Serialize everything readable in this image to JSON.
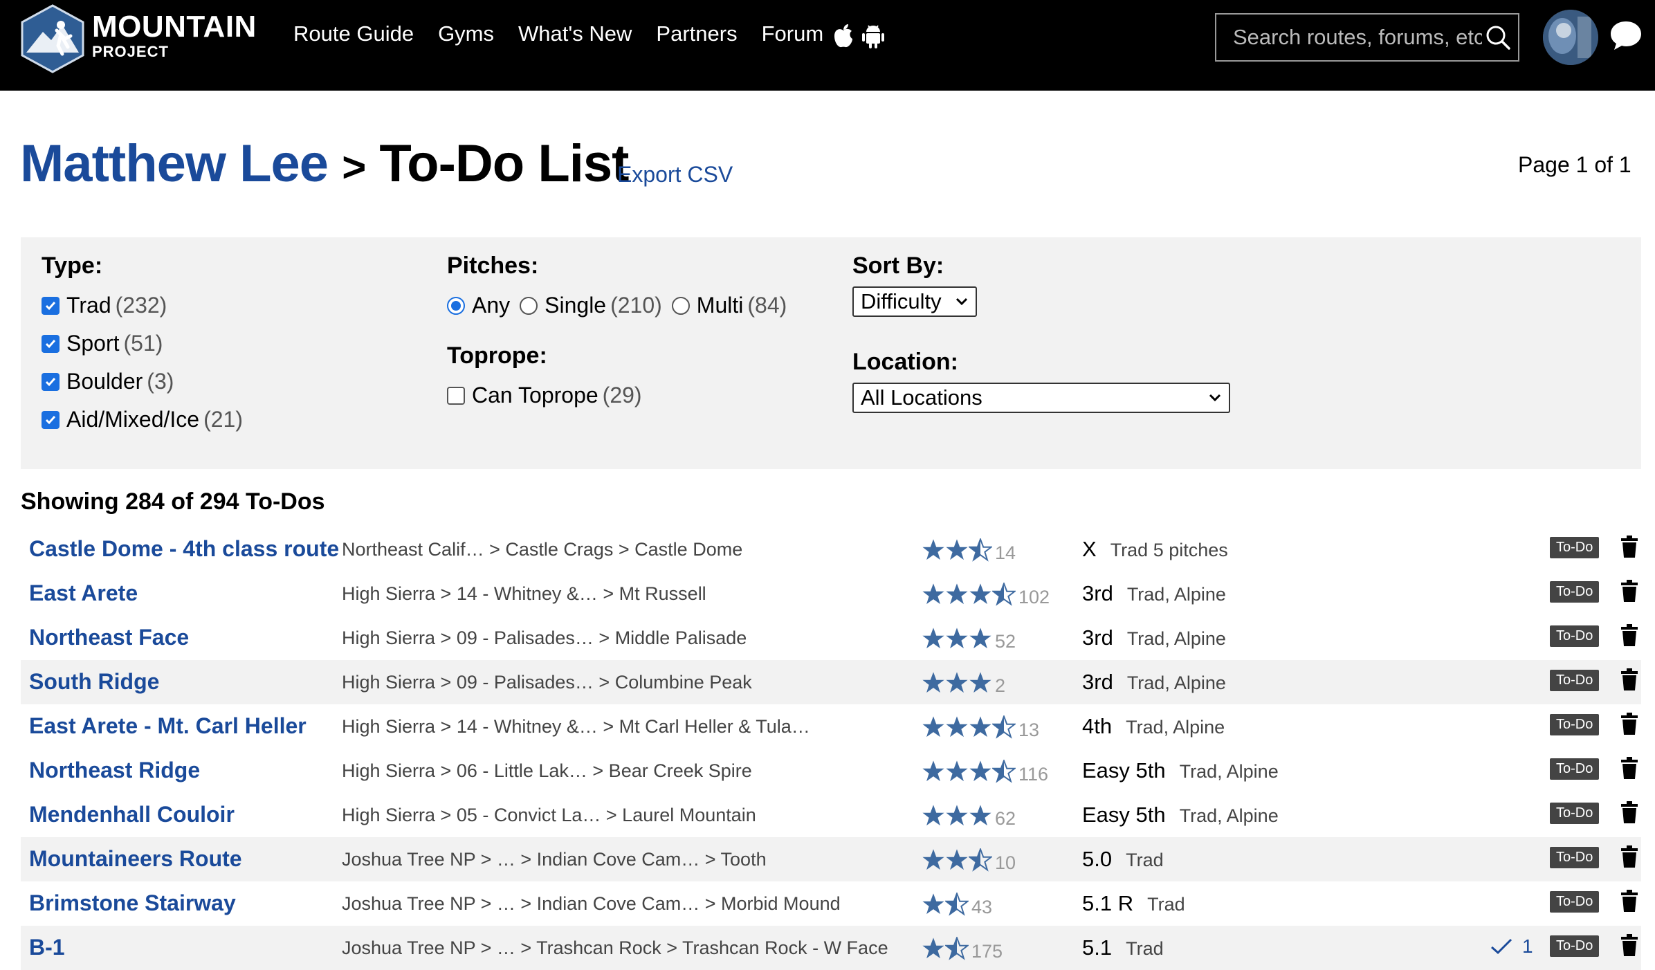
{
  "header": {
    "logo_line1": "MOUNTAIN",
    "logo_line2": "PROJECT",
    "nav": [
      "Route Guide",
      "Gyms",
      "What's New",
      "Partners",
      "Forum"
    ],
    "search_placeholder": "Search routes, forums, etc"
  },
  "title": {
    "user": "Matthew Lee",
    "separator": ">",
    "list": "To-Do List",
    "export": "Export CSV",
    "page": "Page 1 of 1"
  },
  "filters": {
    "type_label": "Type:",
    "types": [
      {
        "label": "Trad",
        "count": "(232)",
        "checked": true
      },
      {
        "label": "Sport",
        "count": "(51)",
        "checked": true
      },
      {
        "label": "Boulder",
        "count": "(3)",
        "checked": true
      },
      {
        "label": "Aid/Mixed/Ice",
        "count": "(21)",
        "checked": true
      }
    ],
    "pitches_label": "Pitches:",
    "pitches": [
      {
        "label": "Any",
        "count": "",
        "selected": true
      },
      {
        "label": "Single",
        "count": "(210)",
        "selected": false
      },
      {
        "label": "Multi",
        "count": "(84)",
        "selected": false
      }
    ],
    "toprope_label": "Toprope:",
    "toprope": {
      "label": "Can Toprope",
      "count": "(29)",
      "checked": false
    },
    "sort_label": "Sort By:",
    "sort_value": "Difficulty",
    "location_label": "Location:",
    "location_value": "All Locations"
  },
  "showing": "Showing 284 of 294 To-Dos",
  "todo_badge": "To-Do",
  "routes": [
    {
      "name": "Castle Dome - 4th class route",
      "path": "Northeast Calif… > Castle Crags > Castle Dome",
      "rating": 2.5,
      "votes": "14",
      "grade": "X",
      "type": "Trad 5 pitches",
      "ticks": ""
    },
    {
      "name": "East Arete",
      "path": "High Sierra > 14 - Whitney &… > Mt Russell",
      "rating": 3.5,
      "votes": "102",
      "grade": "3rd",
      "type": "Trad, Alpine",
      "ticks": ""
    },
    {
      "name": "Northeast Face",
      "path": "High Sierra > 09 - Palisades… > Middle Palisade",
      "rating": 3,
      "votes": "52",
      "grade": "3rd",
      "type": "Trad, Alpine",
      "ticks": ""
    },
    {
      "name": "South Ridge",
      "path": "High Sierra > 09 - Palisades… > Columbine Peak",
      "rating": 3,
      "votes": "2",
      "grade": "3rd",
      "type": "Trad, Alpine",
      "ticks": ""
    },
    {
      "name": "East Arete - Mt. Carl Heller",
      "path": "High Sierra > 14 - Whitney &… > Mt Carl Heller & Tula…",
      "rating": 3.5,
      "votes": "13",
      "grade": "4th",
      "type": "Trad, Alpine",
      "ticks": ""
    },
    {
      "name": "Northeast Ridge",
      "path": "High Sierra > 06 - Little Lak… > Bear Creek Spire",
      "rating": 3.5,
      "votes": "116",
      "grade": "Easy 5th",
      "type": "Trad, Alpine",
      "ticks": ""
    },
    {
      "name": "Mendenhall Couloir",
      "path": "High Sierra > 05 - Convict La… > Laurel Mountain",
      "rating": 3,
      "votes": "62",
      "grade": "Easy 5th",
      "type": "Trad, Alpine",
      "ticks": ""
    },
    {
      "name": "Mountaineers Route",
      "path": "Joshua Tree NP > … > Indian Cove Cam… > Tooth",
      "rating": 2.5,
      "votes": "10",
      "grade": "5.0",
      "type": "Trad",
      "ticks": ""
    },
    {
      "name": "Brimstone Stairway",
      "path": "Joshua Tree NP > … > Indian Cove Cam… > Morbid Mound",
      "rating": 1.5,
      "votes": "43",
      "grade": "5.1 R",
      "type": "Trad",
      "ticks": ""
    },
    {
      "name": "B-1",
      "path": "Joshua Tree NP > … > Trashcan Rock > Trashcan Rock - W Face",
      "rating": 1.5,
      "votes": "175",
      "grade": "5.1",
      "type": "Trad",
      "ticks": "1"
    }
  ],
  "icons": {
    "logo": "mountain-climber-logo",
    "apple": "apple-icon",
    "android": "android-icon",
    "search": "search-icon",
    "chat": "chat-bubble-icon",
    "trash": "trash-icon",
    "tick": "check-icon"
  },
  "colors": {
    "link": "#1a4a9a",
    "star": "#3e6aa0",
    "checkbox": "#1a6fe0",
    "panel": "#f2f2f2"
  }
}
